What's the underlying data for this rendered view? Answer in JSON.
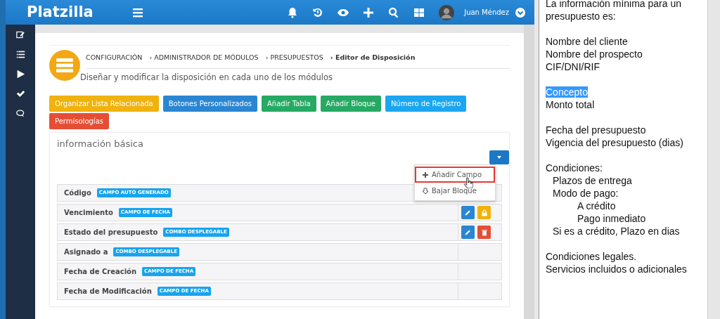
{
  "navbar": {
    "brand": "Platzilla",
    "user": "Juan Méndez"
  },
  "sidebar": {
    "items": [
      {
        "kind": "edit"
      },
      {
        "kind": "list"
      },
      {
        "kind": "play"
      },
      {
        "kind": "check"
      },
      {
        "kind": "chat"
      }
    ]
  },
  "breadcrumb": [
    {
      "label": "CONFIGURACIÓN",
      "current": false
    },
    {
      "label": "› ADMINISTRADOR DE MÓDULOS",
      "current": false
    },
    {
      "label": "› PRESUPUESTOS",
      "current": false
    },
    {
      "label": "› Editor de Disposición",
      "current": true
    }
  ],
  "subtitle": "Diseñar y modificar la disposición en cada uno de los módulos",
  "buttons": [
    {
      "label": "Organizar Lista Relacionada",
      "color": "#f0b20c"
    },
    {
      "label": "Botones Personalizados",
      "color": "#2a86d3"
    },
    {
      "label": "Añadir Tabla",
      "color": "#25a963"
    },
    {
      "label": "Añadir Bloque",
      "color": "#25a963"
    },
    {
      "label": "Número de Registro",
      "color": "#1aa6f0"
    },
    {
      "label": "Permisologías",
      "color": "#e54e35"
    }
  ],
  "block": {
    "title": "información básica",
    "menu": [
      {
        "label": "Añadir Campo",
        "kind": "add",
        "selected": true
      },
      {
        "label": "Bajar Bloque",
        "kind": "down",
        "selected": false
      }
    ],
    "fields": [
      {
        "label": "Código",
        "tag": "CAMPO AUTO GENERADO"
      },
      {
        "label": "Vencimiento",
        "tag": "CAMPO DE FECHA",
        "actions": [
          {
            "kind": "edit"
          },
          {
            "kind": "lock"
          }
        ]
      },
      {
        "label": "Estado del presupuesto",
        "tag": "COMBO DESPLEGABLE",
        "actions": [
          {
            "kind": "edit"
          },
          {
            "kind": "delete"
          }
        ]
      },
      {
        "label": "Asignado a",
        "tag": "COMBO DESPLEGABLE"
      },
      {
        "label": "Fecha de Creación",
        "tag": "CAMPO DE FECHA"
      },
      {
        "label": "Fecha de Modificación",
        "tag": "CAMPO DE FECHA"
      }
    ]
  },
  "notes": [
    {
      "lines": [
        {
          "text": "La información mínima para un presupuesto es:",
          "selected": false
        }
      ]
    },
    {
      "lines": [
        {
          "text": "Nombre del cliente",
          "selected": false
        },
        {
          "text": "Nombre del prospecto",
          "selected": false
        },
        {
          "text": "CIF/DNI/RIF",
          "selected": false
        }
      ]
    },
    {
      "lines": [
        {
          "text": "Concepto",
          "selected": true
        },
        {
          "text": "Monto total",
          "selected": false
        }
      ]
    },
    {
      "lines": [
        {
          "text": "Fecha del presupuesto",
          "selected": false
        },
        {
          "text": "Vigencia del presupuesto (dias)",
          "selected": false
        }
      ]
    },
    {
      "lines": [
        {
          "text": "Condiciones:",
          "selected": false,
          "children": [
            {
              "text": "Plazos de entrega",
              "selected": false
            },
            {
              "text": "Modo de pago:",
              "selected": false,
              "children": [
                {
                  "text": "A crédito",
                  "selected": false
                },
                {
                  "text": "Pago inmediato",
                  "selected": false
                }
              ]
            },
            {
              "text": "Si es a crédito, Plazo en dias",
              "selected": false
            }
          ]
        }
      ]
    },
    {
      "lines": [
        {
          "text": "Condiciones legales.",
          "selected": false
        },
        {
          "text": "Servicios incluidos o adicionales",
          "selected": false
        }
      ]
    }
  ]
}
